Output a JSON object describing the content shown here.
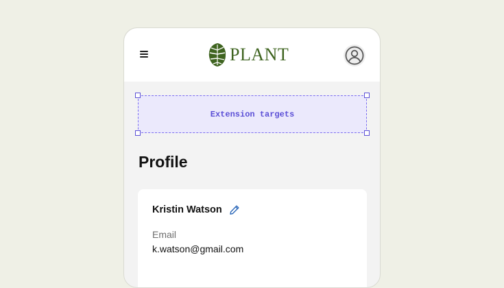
{
  "header": {
    "brand": "PLANT",
    "menu_icon": "hamburger-menu-icon",
    "account_icon": "user-circle-icon",
    "logo_icon": "monstera-leaf-icon"
  },
  "extension": {
    "label": "Extension targets"
  },
  "page": {
    "title": "Profile"
  },
  "profile": {
    "name": "Kristin Watson",
    "edit_icon": "pencil-icon",
    "email_label": "Email",
    "email_value": "k.watson@gmail.com"
  },
  "colors": {
    "background": "#eff0e6",
    "brand": "#3f6420",
    "extension_accent": "#5b4fd6",
    "extension_fill": "#ebe9fc",
    "edit_icon": "#2b67b8"
  }
}
